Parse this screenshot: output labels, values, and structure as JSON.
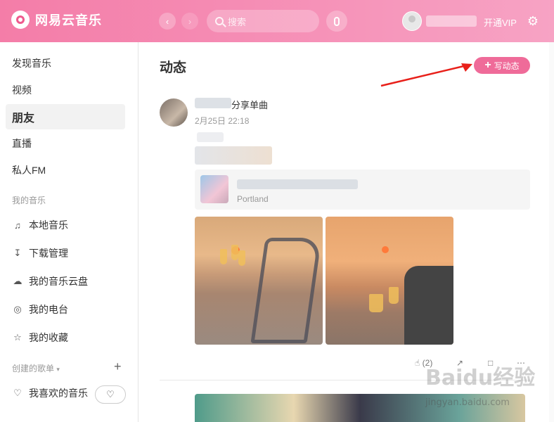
{
  "app": {
    "name": "网易云音乐"
  },
  "header": {
    "back_icon": "chevron-left-icon",
    "forward_icon": "chevron-right-icon",
    "search_placeholder": "搜索",
    "vip_label": "开通VIP"
  },
  "sidebar": {
    "items": [
      {
        "label": "发现音乐"
      },
      {
        "label": "视频"
      },
      {
        "label": "朋友",
        "active": true
      },
      {
        "label": "直播"
      },
      {
        "label": "私人FM"
      }
    ],
    "my_music_title": "我的音乐",
    "my_music": [
      {
        "label": "本地音乐",
        "icon": "music-note-icon"
      },
      {
        "label": "下载管理",
        "icon": "download-icon"
      },
      {
        "label": "我的音乐云盘",
        "icon": "cloud-icon"
      },
      {
        "label": "我的电台",
        "icon": "radio-icon"
      },
      {
        "label": "我的收藏",
        "icon": "collection-icon"
      }
    ],
    "created_playlists_title": "创建的歌单",
    "liked_music": "我喜欢的音乐"
  },
  "main": {
    "title": "动态",
    "write_button": "写动态",
    "post": {
      "action_text": "分享单曲",
      "time": "2月25日 22:18",
      "song_artist": "Portland",
      "likes": "(2)"
    }
  },
  "watermark": {
    "main": "Baidu经验",
    "sub": "jingyan.baidu.com"
  },
  "colors": {
    "accent": "#ef6b99",
    "header": "#f47da8"
  }
}
